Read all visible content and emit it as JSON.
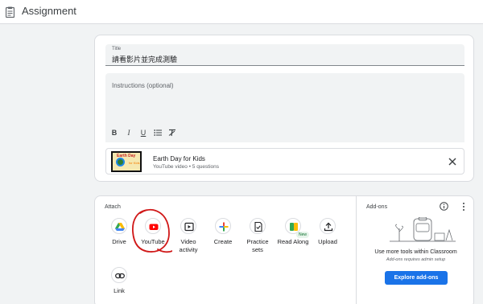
{
  "header": {
    "title": "Assignment"
  },
  "form": {
    "title_label": "Title",
    "title_value": "請看影片並完成測驗",
    "instructions_placeholder": "Instructions (optional)"
  },
  "attachment": {
    "name": "Earth Day for Kids",
    "subtitle": "YouTube video • 5 questions",
    "thumb_text1": "Earth Day",
    "thumb_text2": "for Kids"
  },
  "attach": {
    "title": "Attach",
    "tools": [
      {
        "label": "Drive",
        "icon": "drive-icon"
      },
      {
        "label": "YouTube",
        "icon": "youtube-icon"
      },
      {
        "label": "Video activity",
        "icon": "video-activity-icon"
      },
      {
        "label": "Create",
        "icon": "create-icon"
      },
      {
        "label": "Practice sets",
        "icon": "practice-sets-icon"
      },
      {
        "label": "Read Along",
        "icon": "read-along-icon",
        "badge": "New"
      },
      {
        "label": "Upload",
        "icon": "upload-icon"
      },
      {
        "label": "Link",
        "icon": "link-icon"
      }
    ]
  },
  "addons": {
    "title": "Add-ons",
    "text": "Use more tools within Classroom",
    "sub": "Add-ons requires admin setup",
    "button": "Explore add-ons"
  },
  "colors": {
    "accent": "#1a73e8",
    "youtube": "#ff0000",
    "annotation": "#d01818"
  }
}
